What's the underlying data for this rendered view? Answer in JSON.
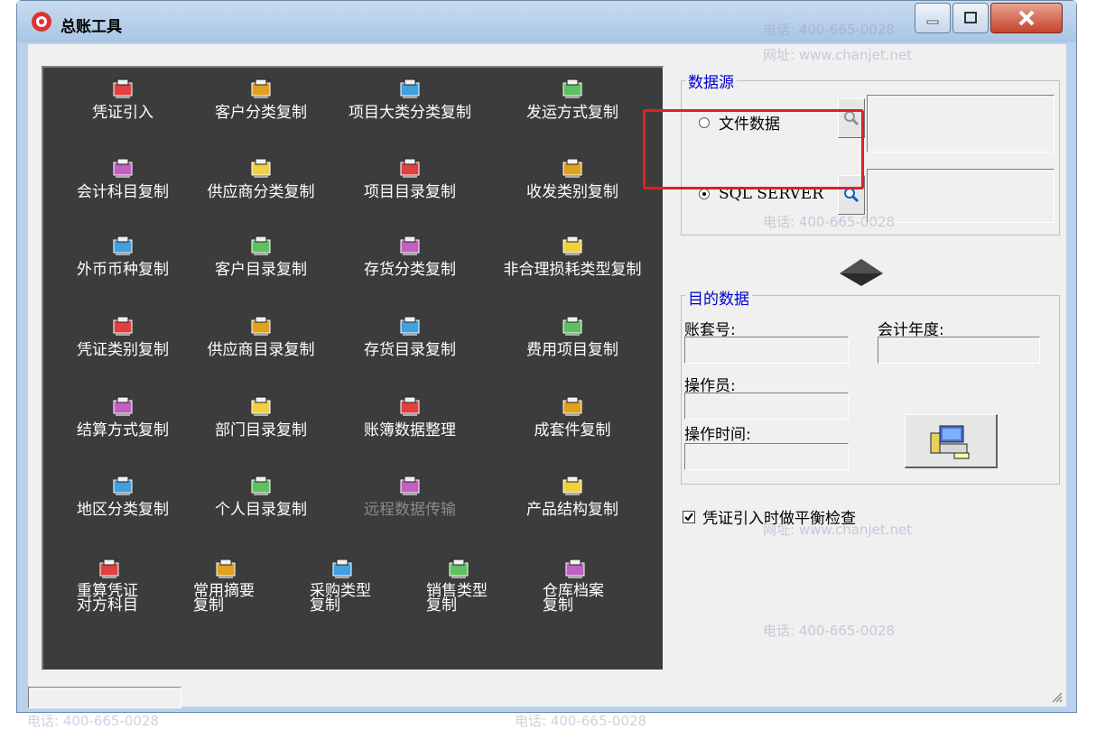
{
  "window": {
    "title": "总账工具"
  },
  "tools": [
    {
      "label": "凭证引入"
    },
    {
      "label": "客户分类复制"
    },
    {
      "label": "项目大类分类复制"
    },
    {
      "label": "发运方式复制"
    },
    {
      "label": "会计科目复制"
    },
    {
      "label": "供应商分类复制"
    },
    {
      "label": "项目目录复制"
    },
    {
      "label": "收发类别复制"
    },
    {
      "label": "外币币种复制"
    },
    {
      "label": "客户目录复制"
    },
    {
      "label": "存货分类复制"
    },
    {
      "label": "非合理损耗类型复制"
    },
    {
      "label": "凭证类别复制"
    },
    {
      "label": "供应商目录复制"
    },
    {
      "label": "存货目录复制"
    },
    {
      "label": "费用项目复制"
    },
    {
      "label": "结算方式复制"
    },
    {
      "label": "部门目录复制"
    },
    {
      "label": "账簿数据整理"
    },
    {
      "label": "成套件复制"
    },
    {
      "label": "地区分类复制"
    },
    {
      "label": "个人目录复制"
    },
    {
      "label": "远程数据传输",
      "disabled": true
    },
    {
      "label": "产品结构复制"
    },
    {
      "label": "重算凭证对方科目"
    },
    {
      "label": "常用摘要复制"
    },
    {
      "label": "采购类型复制"
    },
    {
      "label": "销售类型复制"
    },
    {
      "label": "仓库档案复制"
    }
  ],
  "datasource": {
    "legend": "数据源",
    "option_file": "文件数据",
    "option_sql": "SQL SERVER",
    "selected": "SQL SERVER",
    "file_value": "",
    "sql_value": ""
  },
  "target": {
    "legend": "目的数据",
    "account_label": "账套号:",
    "year_label": "会计年度:",
    "operator_label": "操作员:",
    "time_label": "操作时间:",
    "account_value": "",
    "year_value": "",
    "operator_value": "",
    "time_value": ""
  },
  "options": {
    "balance_check_label": "凭证引入时做平衡检查",
    "balance_check": true
  },
  "status": {
    "text": ""
  },
  "watermark": {
    "phone": "电话: 400-665-0028",
    "site": "网址: www.chanjet.net"
  }
}
